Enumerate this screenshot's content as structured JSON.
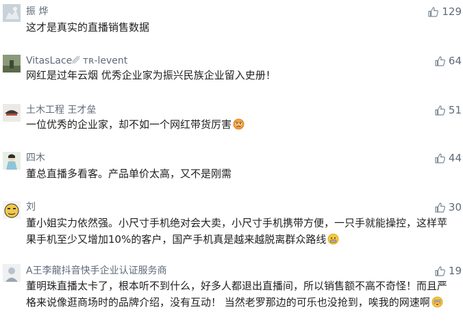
{
  "comments": [
    {
      "user": "振 烨",
      "text": "这才是真实的直播销售数据",
      "likes": "129"
    },
    {
      "user": "VitasLace␥ ᴛʀ-levent",
      "text": "网红是过年云烟 优秀企业家为振兴民族企业留入史册！",
      "likes": "64"
    },
    {
      "user": "土木工程 王才垒",
      "text": "一位优秀的企业家，却不如一个网红带货厉害",
      "likes": "51",
      "emoji": "angry-face-icon"
    },
    {
      "user": "四木",
      "text": "董总直播多看客。产品单价太高，又不是刚需",
      "likes": "44"
    },
    {
      "user": "刘",
      "text": "董小姐实力依然强。小尺寸手机绝对会大卖，小尺寸手机携带方便，一只手就能操控，这样苹果手机至少又增加10%的客户，国产手机真是越来越脱离群众路线",
      "likes": "30",
      "emoji": "grimace-face-icon"
    },
    {
      "user": "A王李龍抖音快手企业认证服务商",
      "text": "董明珠直播太卡了，根本听不到什么，好多人都退出直播间，所以销售额不高不奇怪！而且严格来说像逛商场时的品牌介绍，没有互动！ 当然老罗那边的可乐也没抢到，唉我的网速啊",
      "likes": "19",
      "emoji": "flushed-face-icon"
    }
  ]
}
